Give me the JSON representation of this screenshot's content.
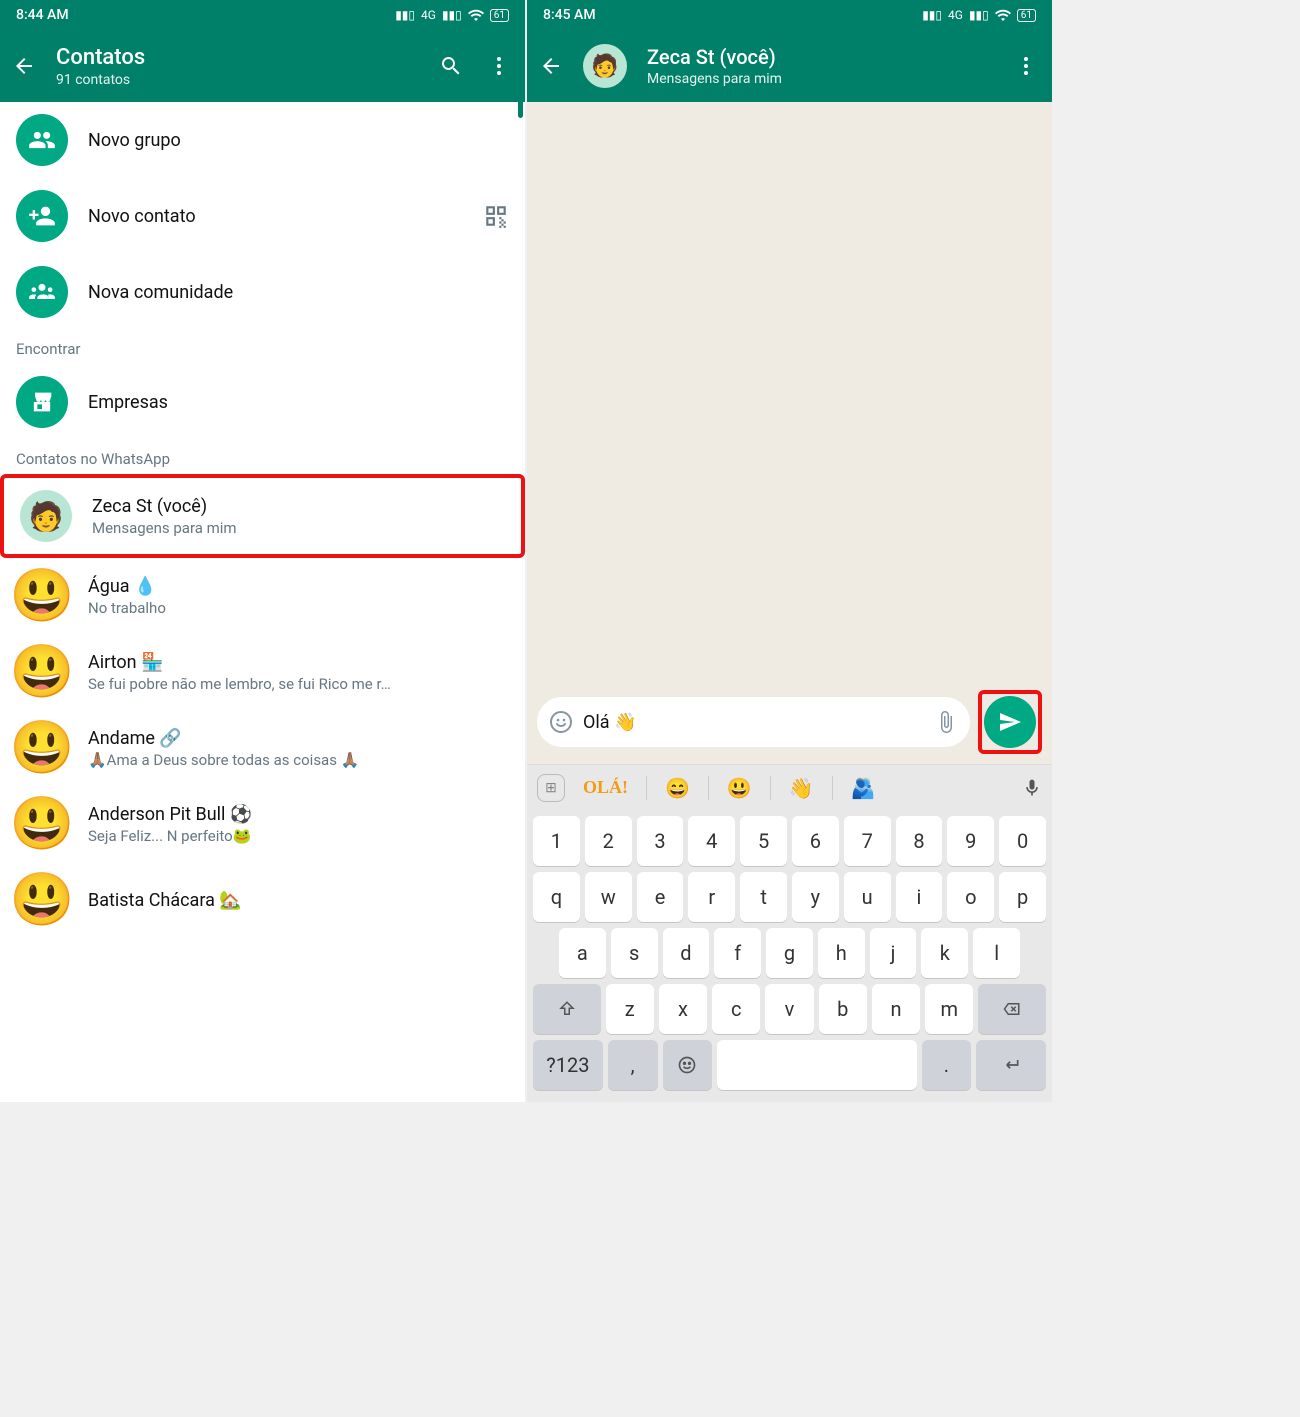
{
  "left": {
    "status_time": "8:44 AM",
    "net_label": "4G",
    "battery": "61",
    "header": {
      "title": "Contatos",
      "subtitle": "91 contatos"
    },
    "actions": [
      {
        "id": "new-group",
        "label": "Novo grupo"
      },
      {
        "id": "new-contact",
        "label": "Novo contato"
      },
      {
        "id": "new-community",
        "label": "Nova comunidade"
      }
    ],
    "find_label": "Encontrar",
    "businesses_label": "Empresas",
    "section_label": "Contatos no WhatsApp",
    "contacts": [
      {
        "name": "Zeca St (você)",
        "status": "Mensagens para mim",
        "avatar": "person",
        "highlight": true
      },
      {
        "name": "Água 💧",
        "status": "No trabalho",
        "avatar": "😃"
      },
      {
        "name": "Airton 🏪",
        "status": "Se fui pobre não me lembro, se fui Rico me r…",
        "avatar": "😃"
      },
      {
        "name": "Andame 🔗",
        "status": "🙏🏽Ama a Deus sobre todas as coisas 🙏🏽",
        "avatar": "😃"
      },
      {
        "name": "Anderson Pit Bull ⚽",
        "status": "Seja Feliz... N perfeito🐸",
        "avatar": "😃"
      },
      {
        "name": "Batista Chácara 🏡",
        "status": "",
        "avatar": "😃"
      }
    ]
  },
  "right": {
    "status_time": "8:45 AM",
    "net_label": "4G",
    "battery": "61",
    "header": {
      "title": "Zeca St (você)",
      "subtitle": "Mensagens para mim"
    },
    "input_text": "Olá 👋",
    "suggestions": {
      "ola": "OLÁ!",
      "emojis": [
        "😄",
        "😃",
        "👋",
        "🫂"
      ]
    },
    "keyboard": {
      "row1": [
        "1",
        "2",
        "3",
        "4",
        "5",
        "6",
        "7",
        "8",
        "9",
        "0"
      ],
      "row2": [
        "q",
        "w",
        "e",
        "r",
        "t",
        "y",
        "u",
        "i",
        "o",
        "p"
      ],
      "row3": [
        "a",
        "s",
        "d",
        "f",
        "g",
        "h",
        "j",
        "k",
        "l"
      ],
      "row4": [
        "z",
        "x",
        "c",
        "v",
        "b",
        "n",
        "m"
      ],
      "sym": "?123",
      "comma": ",",
      "period": "."
    }
  }
}
